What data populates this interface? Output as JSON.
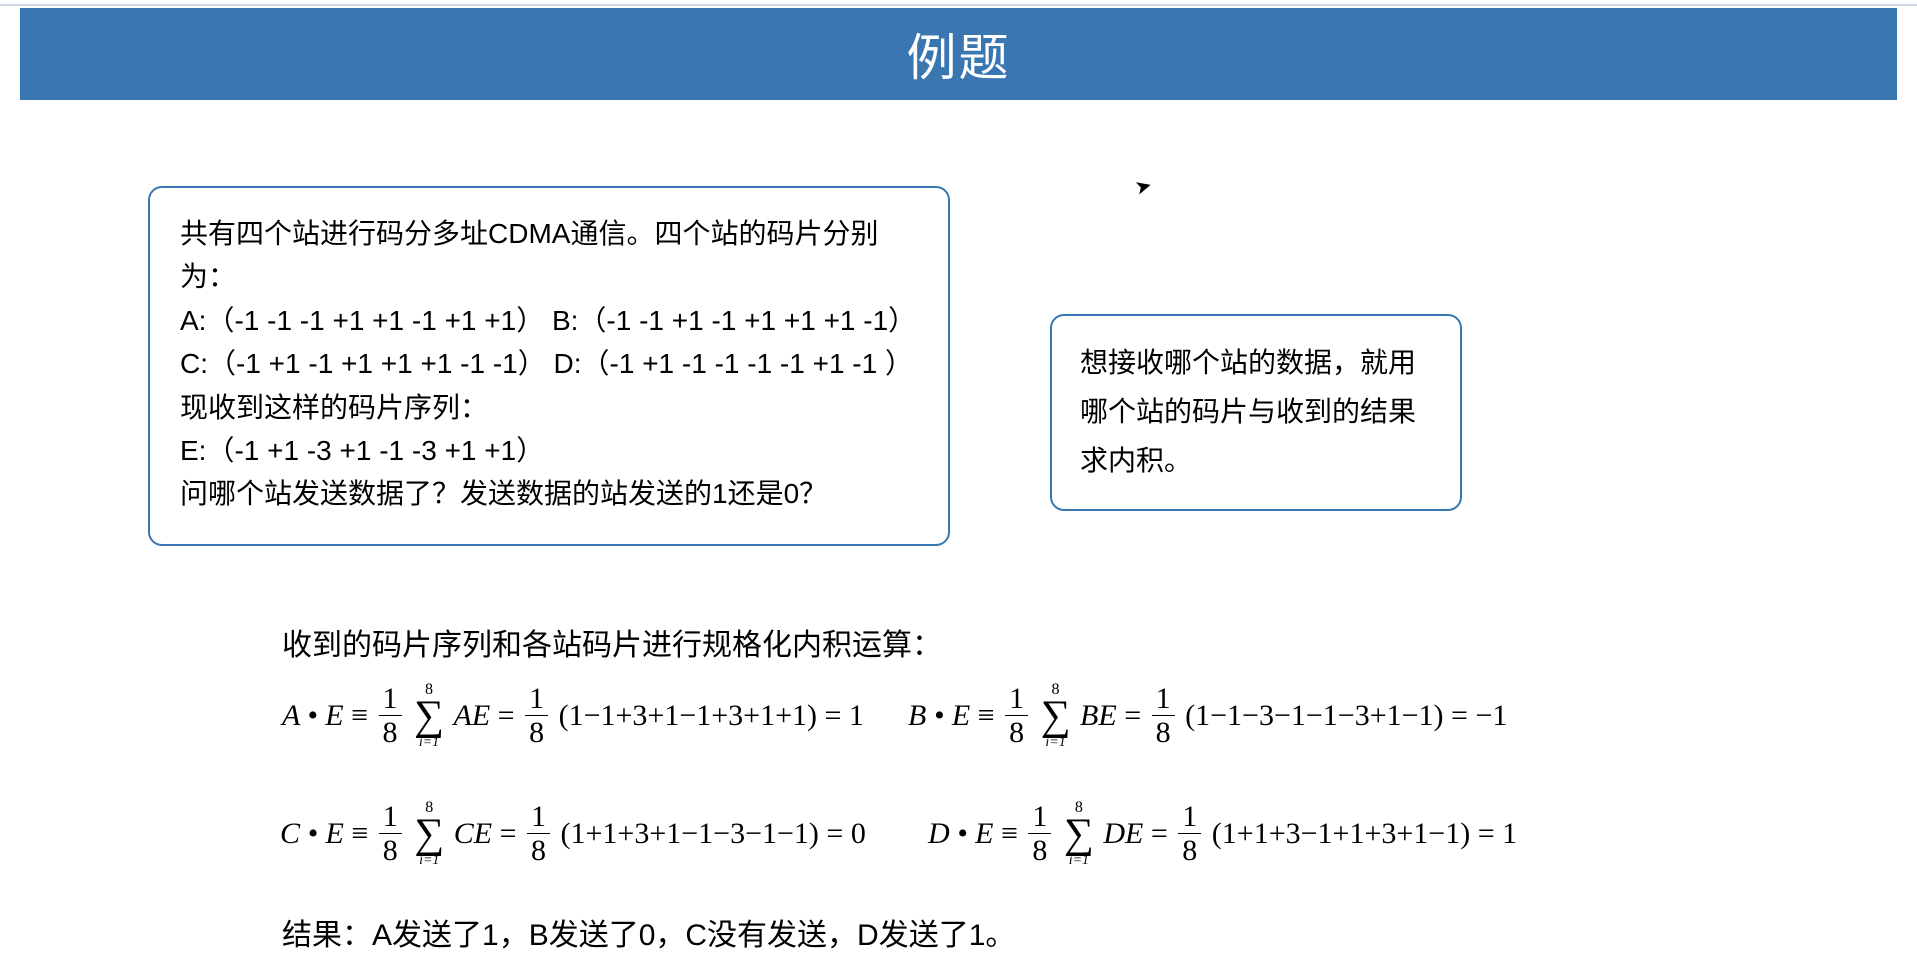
{
  "banner": {
    "title": "例题"
  },
  "problem": {
    "line1": "共有四个站进行码分多址CDMA通信。四个站的码片分别为：",
    "line2": "A:（-1 -1 -1 +1 +1 -1 +1 +1）  B:（-1 -1 +1 -1 +1 +1 +1 -1）",
    "line3": "C:（-1 +1 -1 +1 +1 +1 -1 -1）  D:（-1 +1 -1 -1 -1 -1 +1 -1 ）",
    "line4": "现收到这样的码片序列：",
    "line5": "E:（-1 +1 -3 +1 -1 -3 +1 +1）",
    "line6": "问哪个站发送数据了？发送数据的站发送的1还是0？"
  },
  "hint": {
    "text": "想接收哪个站的数据，就用哪个站的码片与收到的结果求内积。"
  },
  "solution": {
    "heading": "收到的码片序列和各站码片进行规格化内积运算：",
    "common": {
      "frac_num": "1",
      "frac_den": "8",
      "sigma_top": "8",
      "sigma_bottom": "i=1"
    },
    "A": {
      "lhs": "A • E",
      "term": "AE",
      "expansion": "(1−1+3+1−1+3+1+1) = 1"
    },
    "B": {
      "lhs": "B • E",
      "term": "BE",
      "expansion": "(1−1−3−1−1−3+1−1) = −1"
    },
    "C": {
      "lhs": "C • E",
      "term": "CE",
      "expansion": "(1+1+3+1−1−3−1−1) = 0"
    },
    "D": {
      "lhs": "D • E",
      "term": "DE",
      "expansion": "(1+1+3−1+1+3+1−1) = 1"
    },
    "result": "结果：A发送了1，B发送了0，C没有发送，D发送了1。"
  },
  "glyphs": {
    "equiv": "≡",
    "equals": "=",
    "sigma": "∑",
    "cursor": "➤"
  }
}
